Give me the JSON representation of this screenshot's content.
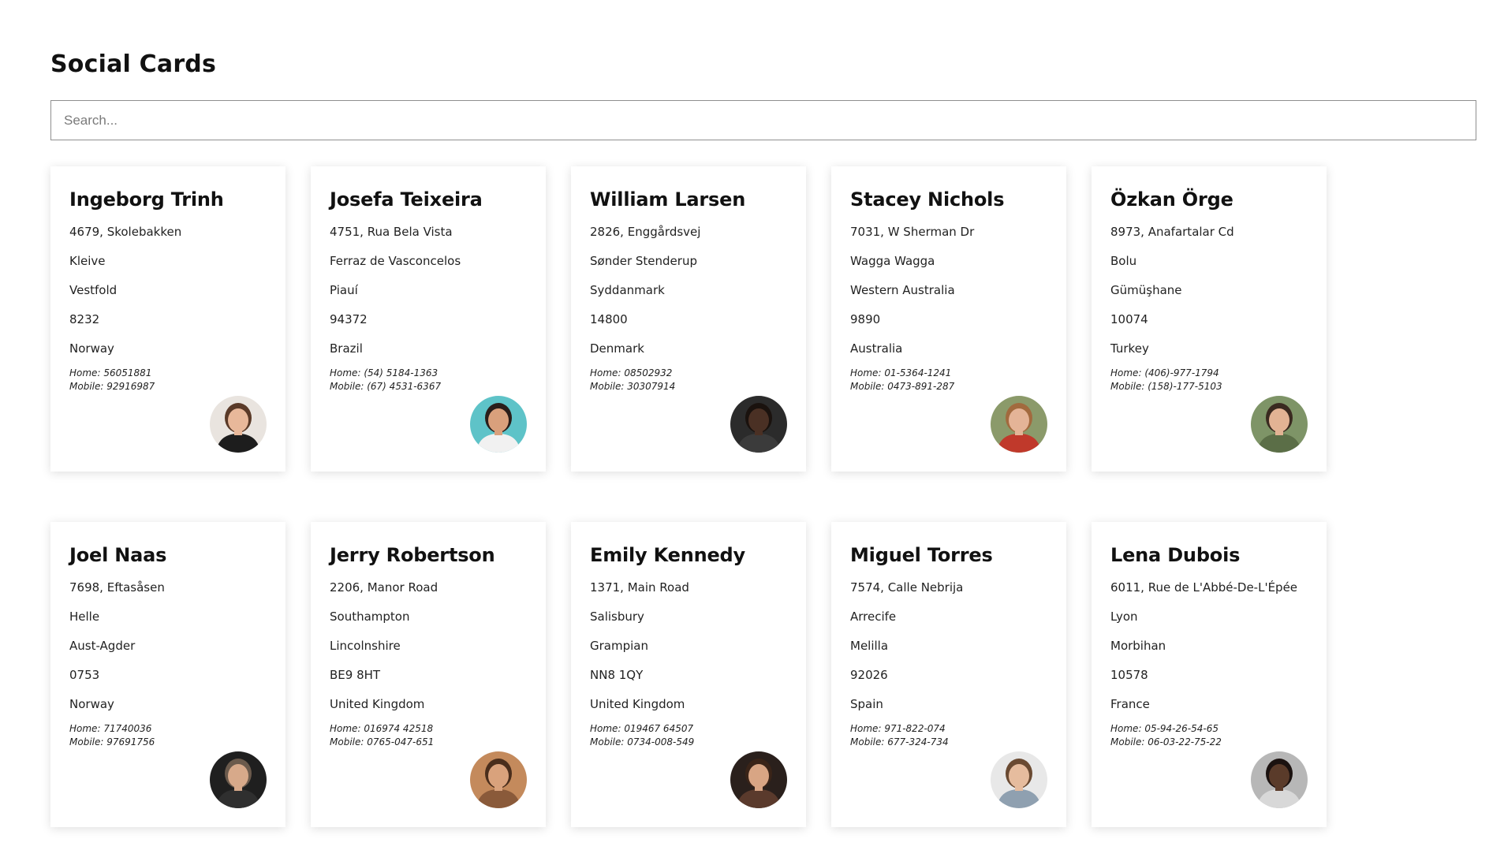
{
  "header": {
    "title": "Social Cards"
  },
  "search": {
    "placeholder": "Search...",
    "value": ""
  },
  "cards": [
    {
      "name": "Ingeborg Trinh",
      "address": [
        "4679, Skolebakken",
        "Kleive",
        "Vestfold",
        "8232",
        "Norway"
      ],
      "home_label": "Home:",
      "home": "56051881",
      "mobile_label": "Mobile:",
      "mobile": "92916987",
      "avatar": {
        "bg": "#e9e4df",
        "skin": "#e8b89a",
        "hair": "#5a3a28",
        "shirt": "#1d1d1d"
      }
    },
    {
      "name": "Josefa Teixeira",
      "address": [
        "4751, Rua Bela Vista",
        "Ferraz de Vasconcelos",
        "Piauí",
        "94372",
        "Brazil"
      ],
      "home_label": "Home:",
      "home": "(54) 5184-1363",
      "mobile_label": "Mobile:",
      "mobile": "(67) 4531-6367",
      "avatar": {
        "bg": "#5ec3c8",
        "skin": "#d9a07c",
        "hair": "#2a1e1a",
        "shirt": "#f1f1f1"
      }
    },
    {
      "name": "William Larsen",
      "address": [
        "2826, Enggårdsvej",
        "Sønder Stenderup",
        "Syddanmark",
        "14800",
        "Denmark"
      ],
      "home_label": "Home:",
      "home": "08502932",
      "mobile_label": "Mobile:",
      "mobile": "30307914",
      "avatar": {
        "bg": "#2b2b2b",
        "skin": "#4a3024",
        "hair": "#1a120e",
        "shirt": "#3b3b3b"
      }
    },
    {
      "name": "Stacey Nichols",
      "address": [
        "7031, W Sherman Dr",
        "Wagga Wagga",
        "Western Australia",
        "9890",
        "Australia"
      ],
      "home_label": "Home:",
      "home": "01-5364-1241",
      "mobile_label": "Mobile:",
      "mobile": "0473-891-287",
      "avatar": {
        "bg": "#8b9a6a",
        "skin": "#e4b497",
        "hair": "#a26a3e",
        "shirt": "#c0392b"
      }
    },
    {
      "name": "Özkan Örge",
      "address": [
        "8973, Anafartalar Cd",
        "Bolu",
        "Gümüşhane",
        "10074",
        "Turkey"
      ],
      "home_label": "Home:",
      "home": "(406)-977-1794",
      "mobile_label": "Mobile:",
      "mobile": "(158)-177-5103",
      "avatar": {
        "bg": "#7e9467",
        "skin": "#e2b394",
        "hair": "#3a2a20",
        "shirt": "#5b6e47"
      }
    },
    {
      "name": "Joel Naas",
      "address": [
        "7698, Eftasåsen",
        "Helle",
        "Aust-Agder",
        "0753",
        "Norway"
      ],
      "home_label": "Home:",
      "home": "71740036",
      "mobile_label": "Mobile:",
      "mobile": "97691756",
      "avatar": {
        "bg": "#1f1f1f",
        "skin": "#d7a98a",
        "hair": "#6b5a4c",
        "shirt": "#2f2f2f"
      }
    },
    {
      "name": "Jerry Robertson",
      "address": [
        "2206, Manor Road",
        "Southampton",
        "Lincolnshire",
        "BE9 8HT",
        "United Kingdom"
      ],
      "home_label": "Home:",
      "home": "016974 42518",
      "mobile_label": "Mobile:",
      "mobile": "0765-047-651",
      "avatar": {
        "bg": "#c48a5c",
        "skin": "#d9a27c",
        "hair": "#4a2e1c",
        "shirt": "#8a5a3a"
      }
    },
    {
      "name": "Emily Kennedy",
      "address": [
        "1371, Main Road",
        "Salisbury",
        "Grampian",
        "NN8 1QY",
        "United Kingdom"
      ],
      "home_label": "Home:",
      "home": "019467 64507",
      "mobile_label": "Mobile:",
      "mobile": "0734-008-549",
      "avatar": {
        "bg": "#2a201c",
        "skin": "#d8a584",
        "hair": "#3a2418",
        "shirt": "#5a3a2c"
      }
    },
    {
      "name": "Miguel Torres",
      "address": [
        "7574, Calle Nebrija",
        "Arrecife",
        "Melilla",
        "92026",
        "Spain"
      ],
      "home_label": "Home:",
      "home": "971-822-074",
      "mobile_label": "Mobile:",
      "mobile": "677-324-734",
      "avatar": {
        "bg": "#e8e8e8",
        "skin": "#e6bc9e",
        "hair": "#6a4a32",
        "shirt": "#8fa0b0"
      }
    },
    {
      "name": "Lena Dubois",
      "address": [
        "6011, Rue de L'Abbé-De-L'Épée",
        "Lyon",
        "Morbihan",
        "10578",
        "France"
      ],
      "home_label": "Home:",
      "home": "05-94-26-54-65",
      "mobile_label": "Mobile:",
      "mobile": "06-03-22-75-22",
      "avatar": {
        "bg": "#b7b7b7",
        "skin": "#5a3b2a",
        "hair": "#1b1210",
        "shirt": "#d8d8d8"
      }
    }
  ]
}
